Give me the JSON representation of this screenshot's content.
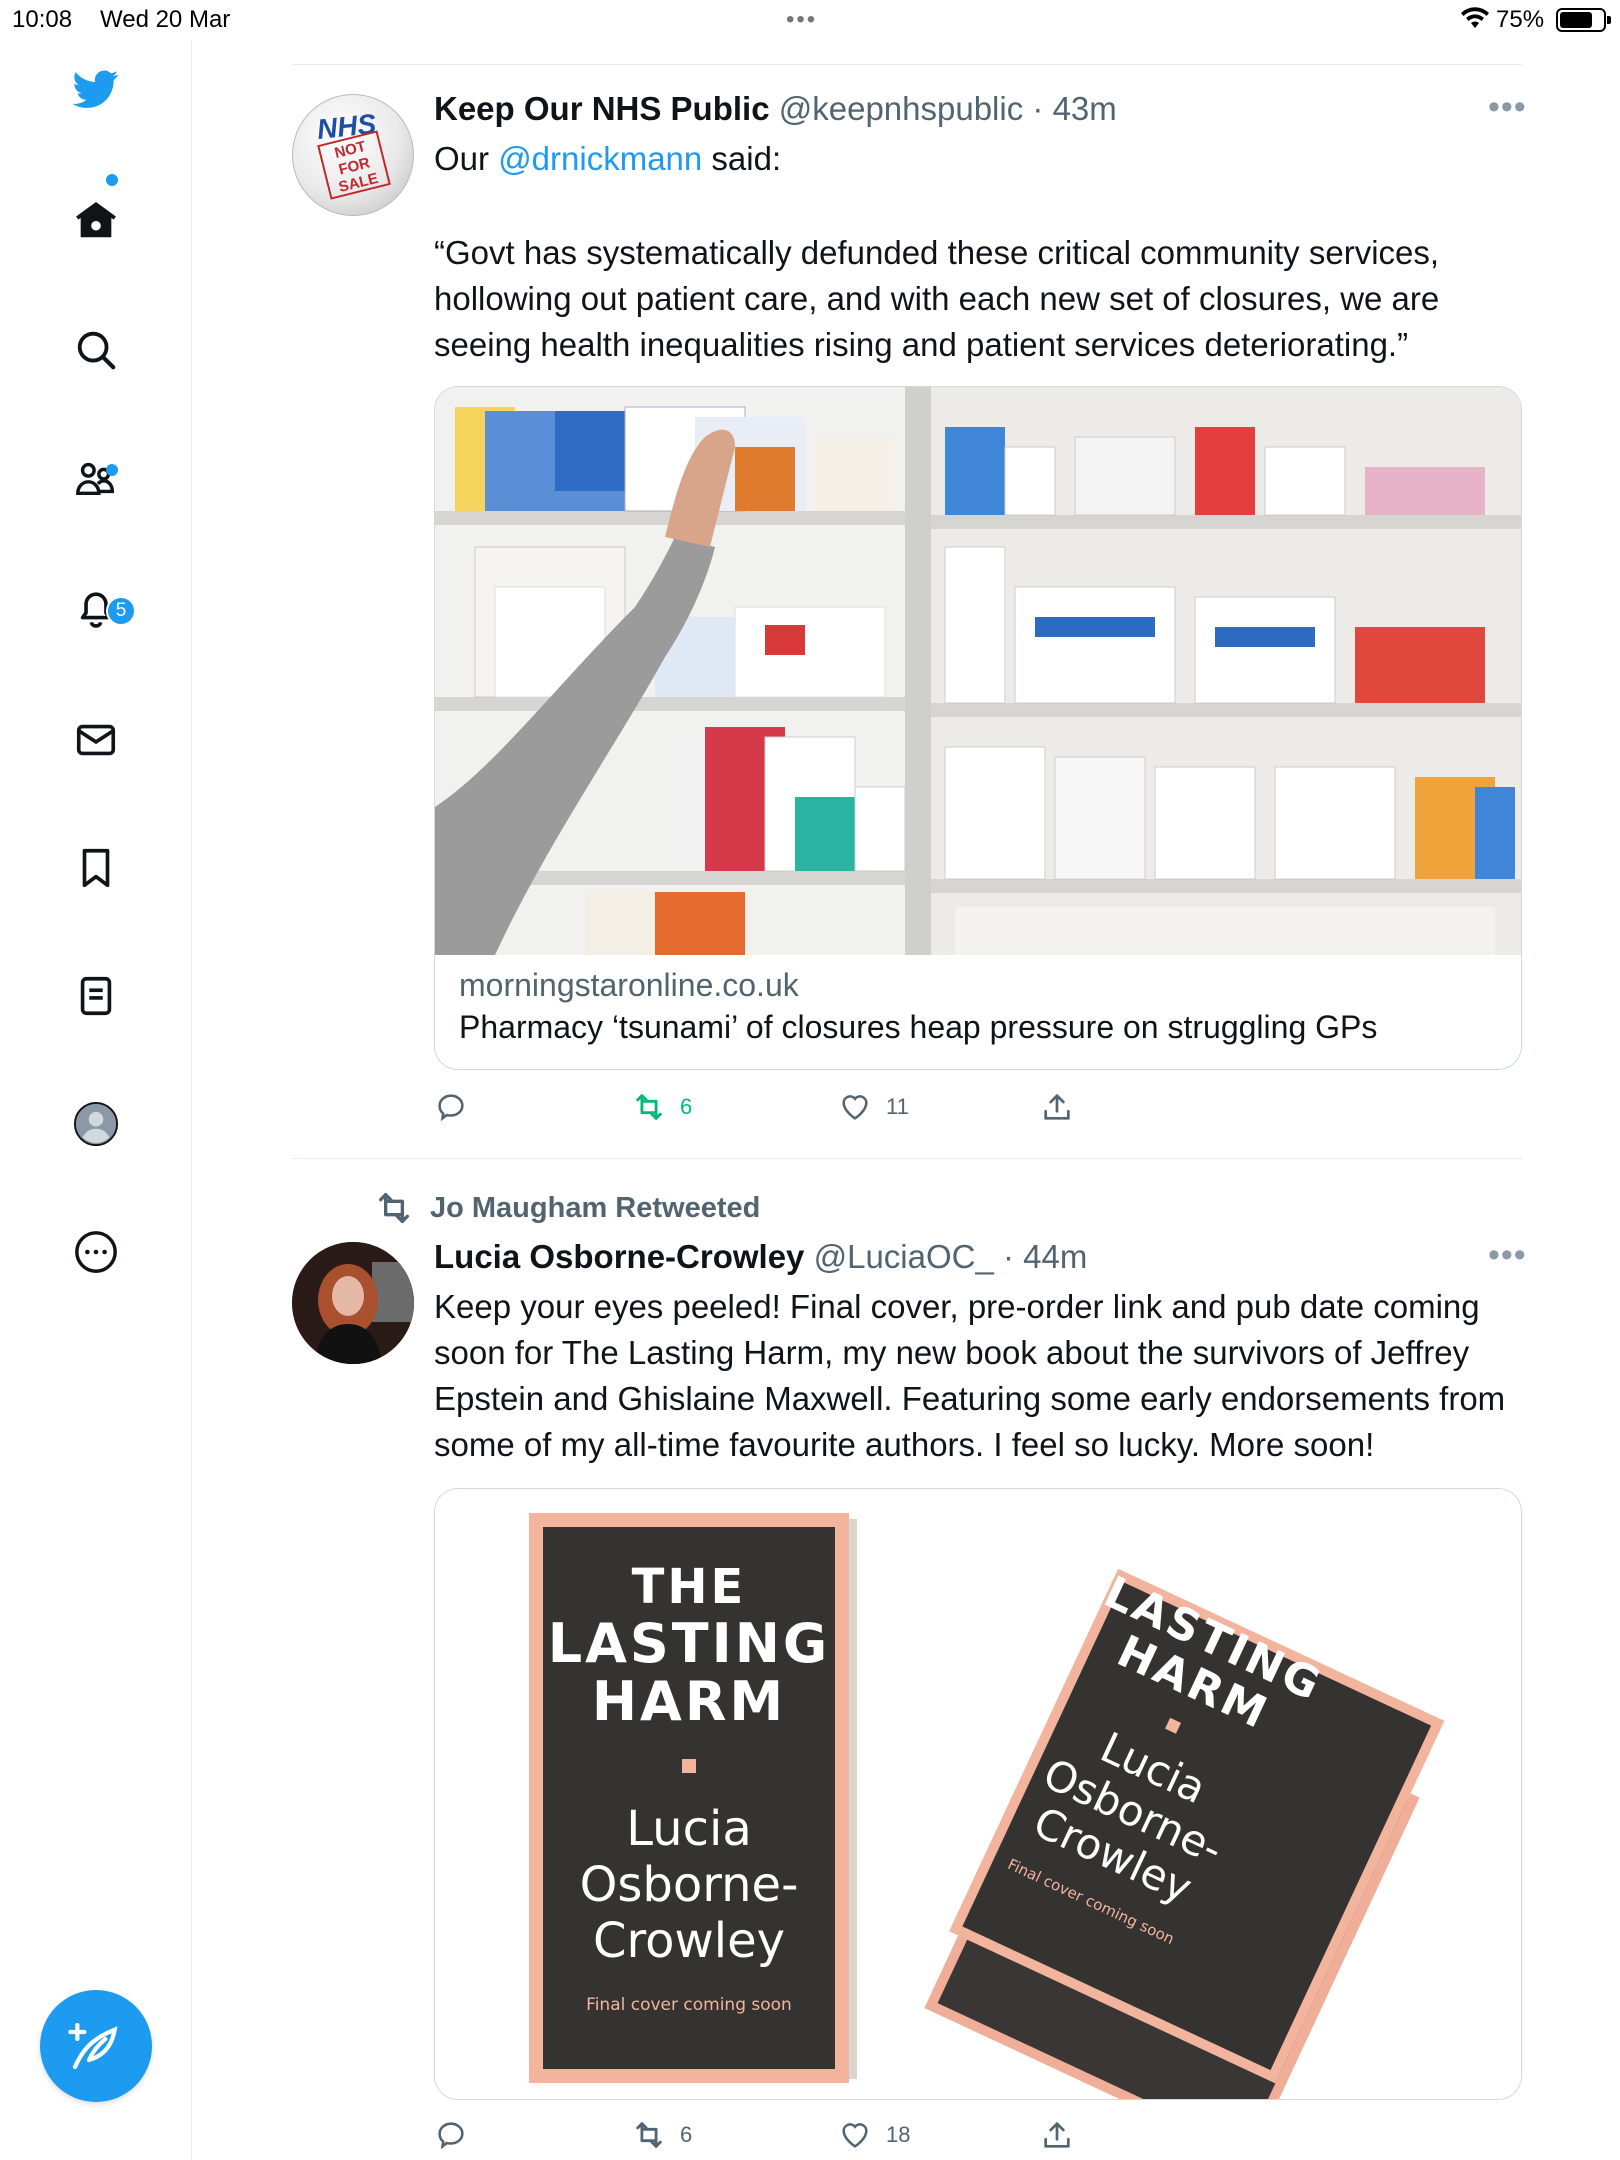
{
  "status_bar": {
    "time": "10:08",
    "date": "Wed 20 Mar",
    "battery_percent": "75%",
    "battery_level": 0.75,
    "center_dots": "•••"
  },
  "sidebar": {
    "items": [
      {
        "icon": "twitter-logo-icon"
      },
      {
        "icon": "home-icon",
        "has_dot": true
      },
      {
        "icon": "search-icon"
      },
      {
        "icon": "communities-icon",
        "has_dot": true
      },
      {
        "icon": "notifications-icon",
        "badge": "5"
      },
      {
        "icon": "messages-icon"
      },
      {
        "icon": "bookmarks-icon"
      },
      {
        "icon": "lists-icon"
      },
      {
        "icon": "profile-icon"
      },
      {
        "icon": "more-icon"
      }
    ],
    "notification_badge": "5",
    "compose_icon": "compose-feather-icon"
  },
  "colors": {
    "accent": "#1d9bf0",
    "retweet_active": "#00ba7c",
    "secondary_text": "#536471",
    "border": "#cfd9de"
  },
  "tweets": [
    {
      "name": "Keep Our NHS Public",
      "handle": "@keepnhspublic",
      "time": "· 43m",
      "text_prefix": "Our ",
      "mention": "@drnickmann",
      "text_suffix": " said:",
      "quote": "“Govt has systematically defunded these critical community services, hollowing out patient care, and with each new set of closures, we are seeing health inequalities rising and patient services deteriorating.”",
      "card": {
        "domain": "morningstaronline.co.uk",
        "title": "Pharmacy ‘tsunami’ of closures heap pressure on struggling GPs"
      },
      "avatar": {
        "line1": "NHS",
        "line2": "NOT",
        "line3": "FOR",
        "line4": "SALE"
      },
      "actions": {
        "replies": "",
        "retweets": "6",
        "likes": "11"
      }
    },
    {
      "retweeted_by": "Jo Maugham Retweeted",
      "name": "Lucia Osborne-Crowley",
      "handle": "@LuciaOC_",
      "time": "· 44m",
      "text": "Keep your eyes peeled! Final cover, pre-order link and pub date coming soon for The Lasting Harm, my new book about the survivors of Jeffrey Epstein and Ghislaine Maxwell. Featuring some early endorsements from some of my all-time favourite authors. I feel so lucky. More soon!",
      "book": {
        "title_line1": "THE",
        "title_line2": "LASTING",
        "title_line3": "HARM",
        "author_line1": "Lucia",
        "author_line2": "Osborne-",
        "author_line3": "Crowley",
        "footer": "Final cover coming soon"
      },
      "actions": {
        "replies": "",
        "retweets": "6",
        "likes": "18"
      }
    }
  ],
  "more_label": "•••"
}
